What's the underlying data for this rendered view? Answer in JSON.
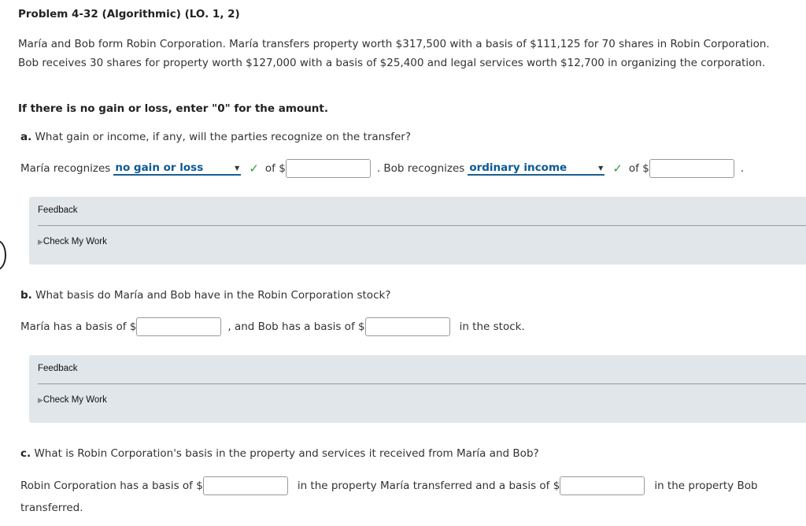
{
  "title": "Problem 4-32 (Algorithmic) (LO. 1, 2)",
  "intro": "María and Bob form Robin Corporation. María transfers property worth $317,500 with a basis of $111,125 for 70 shares in Robin Corporation. Bob receives 30 shares for property worth $127,000 with a basis of $25,400 and legal services worth $12,700 in organizing the corporation.",
  "instruction": "If there is no gain or loss, enter \"0\" for the amount.",
  "part_a": {
    "letter": "a.",
    "question": "What gain or income, if any, will the parties recognize on the transfer?",
    "maria_label": "María recognizes",
    "maria_select": "no gain or loss",
    "of1": "of $",
    "bob_label": ". Bob recognizes",
    "bob_select": "ordinary income",
    "of2": "of $",
    "end": ".",
    "maria_amount": "",
    "bob_amount": ""
  },
  "part_b": {
    "letter": "b.",
    "question": "What basis do María and Bob have in the Robin Corporation stock?",
    "t1": "María has a basis of $",
    "t2": ", and Bob has a basis of $",
    "t3": "in the stock."
  },
  "part_c": {
    "letter": "c.",
    "question": "What is Robin Corporation's basis in the property and services it received from María and Bob?",
    "t1": "Robin Corporation has a basis of $",
    "t2": "in the property María transferred and a basis of $",
    "t3": "in the property Bob",
    "t4": "transferred."
  },
  "feedback": {
    "label": "Feedback",
    "check": "Check My Work"
  },
  "colors": {
    "select_text": "#0a5a96",
    "check": "#2e9e3c",
    "feedback_bg": "#e0e6ea"
  }
}
